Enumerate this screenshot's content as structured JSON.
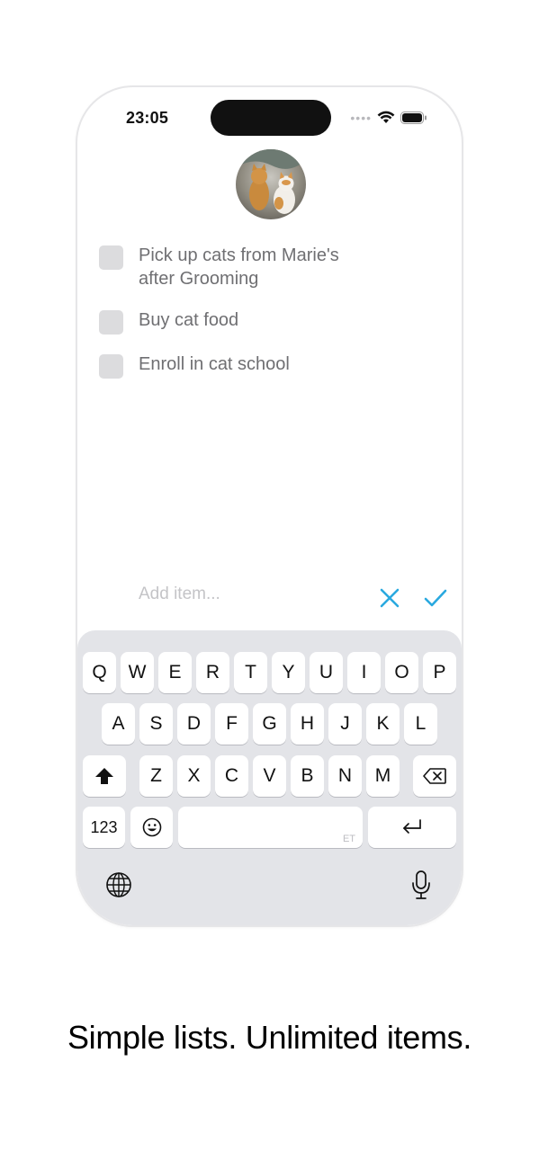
{
  "status_bar": {
    "time": "23:05"
  },
  "avatar": {
    "icon": "cats-photo-avatar"
  },
  "todo": {
    "items": [
      {
        "label": "Pick up cats from Marie's after Grooming",
        "checked": false
      },
      {
        "label": "Buy cat food",
        "checked": false
      },
      {
        "label": "Enroll in cat school",
        "checked": false
      }
    ]
  },
  "add_item": {
    "placeholder": "Add item...",
    "value": ""
  },
  "colors": {
    "accent": "#2aa9df",
    "checkbox": "#dcdcde",
    "keyboard_bg": "#e3e4e8"
  },
  "keyboard": {
    "row1": [
      "Q",
      "W",
      "E",
      "R",
      "T",
      "Y",
      "U",
      "I",
      "O",
      "P"
    ],
    "row2": [
      "A",
      "S",
      "D",
      "F",
      "G",
      "H",
      "J",
      "K",
      "L"
    ],
    "row3": [
      "Z",
      "X",
      "C",
      "V",
      "B",
      "N",
      "M"
    ],
    "numbers_label": "123",
    "space_language": "ET"
  },
  "tagline": "Simple lists. Unlimited items."
}
